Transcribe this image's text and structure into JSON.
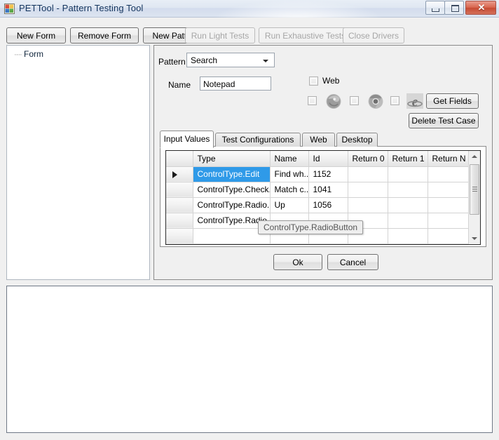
{
  "window": {
    "title": "PETTool - Pattern Testing Tool",
    "app_icon": "form-designer-icon",
    "controls": {
      "minimize": "minimize-icon",
      "maximize": "maximize-icon",
      "close": "✕"
    }
  },
  "toolbar": {
    "buttons": [
      {
        "label": "New Form",
        "enabled": true
      },
      {
        "label": "Remove Form",
        "enabled": true
      },
      {
        "label": "New Pattern",
        "enabled": true
      },
      {
        "label": "Run Light Tests",
        "enabled": false
      },
      {
        "label": "Run Exhaustive Tests",
        "enabled": false
      },
      {
        "label": "Close Drivers",
        "enabled": false
      }
    ]
  },
  "tree": {
    "items": [
      {
        "label": "Form",
        "prefix": "····"
      }
    ]
  },
  "form": {
    "pattern_label": "Pattern",
    "pattern_value": "Search",
    "name_label": "Name",
    "name_value": "Notepad",
    "web_checkbox_label": "Web",
    "web_checkbox_checked": false,
    "browsers": [
      {
        "name": "firefox-icon",
        "checked": false
      },
      {
        "name": "chrome-icon",
        "checked": false
      },
      {
        "name": "internet-explorer-icon",
        "checked": false
      }
    ],
    "get_fields_label": "Get Fields",
    "delete_test_case_label": "Delete Test Case"
  },
  "tabs": [
    {
      "label": "Input Values",
      "active": true
    },
    {
      "label": "Test Configurations",
      "active": false
    },
    {
      "label": "Web",
      "active": false
    },
    {
      "label": "Desktop",
      "active": false
    }
  ],
  "grid": {
    "columns": [
      "Type",
      "Name",
      "Id",
      "Return 0",
      "Return 1",
      "Return N"
    ],
    "rows": [
      {
        "current": true,
        "selected": true,
        "type": "ControlType.Edit",
        "name": "Find wh...",
        "id": "1152",
        "return0": "",
        "return1": "",
        "returnN": ""
      },
      {
        "current": false,
        "selected": false,
        "type": "ControlType.Check...",
        "name": "Match c...",
        "id": "1041",
        "return0": "",
        "return1": "",
        "returnN": ""
      },
      {
        "current": false,
        "selected": false,
        "type": "ControlType.Radio...",
        "name": "Up",
        "id": "1056",
        "return0": "",
        "return1": "",
        "returnN": ""
      },
      {
        "current": false,
        "selected": false,
        "type": "ControlType.Radio",
        "name": "",
        "id": "",
        "return0": "",
        "return1": "",
        "returnN": ""
      },
      {
        "current": false,
        "selected": false,
        "type": "",
        "name": "",
        "id": "",
        "return0": "",
        "return1": "",
        "returnN": ""
      }
    ]
  },
  "tooltip": {
    "text": "ControlType.RadioButton"
  },
  "dialog": {
    "ok_label": "Ok",
    "cancel_label": "Cancel"
  },
  "colors": {
    "selection": "#2f9ae8",
    "title_text": "#14355e",
    "close_button": "#c64b33"
  }
}
